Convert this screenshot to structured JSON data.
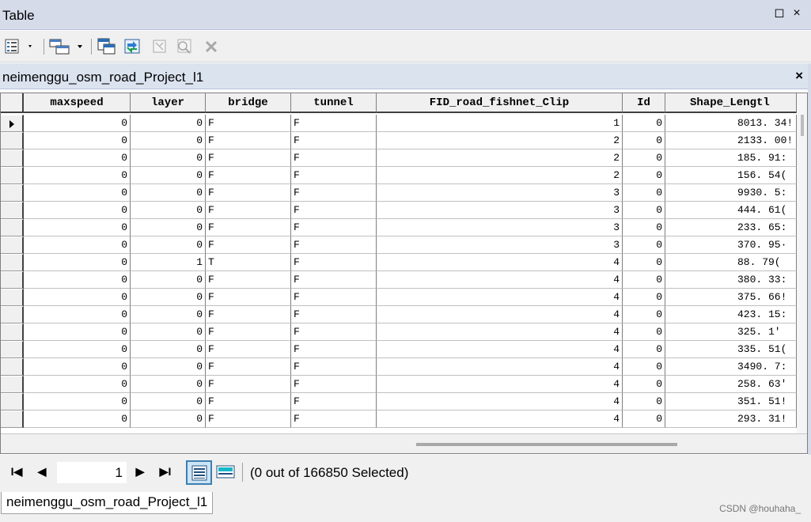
{
  "window": {
    "title": "Table",
    "restore_glyph": "◻",
    "close_glyph": "×"
  },
  "toolbar": {
    "icons": [
      "table-options-icon",
      "related-tables-icon",
      "select-by-attributes-icon",
      "switch-selection-icon",
      "clear-selection-icon",
      "zoom-to-selected-icon",
      "delete-selected-icon"
    ]
  },
  "tab": {
    "title": "neimenggu_osm_road_Project_l1",
    "close_glyph": "×"
  },
  "table": {
    "columns": [
      "maxspeed",
      "layer",
      "bridge",
      "tunnel",
      "FID_road_fishnet_Clip",
      "Id",
      "Shape_Lengtl"
    ],
    "rows": [
      [
        "0",
        "0",
        "F",
        "F",
        "1",
        "0",
        "8013. 34!"
      ],
      [
        "0",
        "0",
        "F",
        "F",
        "2",
        "0",
        "2133. 00!"
      ],
      [
        "0",
        "0",
        "F",
        "F",
        "2",
        "0",
        "185. 91:"
      ],
      [
        "0",
        "0",
        "F",
        "F",
        "2",
        "0",
        "156. 54("
      ],
      [
        "0",
        "0",
        "F",
        "F",
        "3",
        "0",
        "9930. 5:"
      ],
      [
        "0",
        "0",
        "F",
        "F",
        "3",
        "0",
        "444. 61("
      ],
      [
        "0",
        "0",
        "F",
        "F",
        "3",
        "0",
        "233. 65:"
      ],
      [
        "0",
        "0",
        "F",
        "F",
        "3",
        "0",
        "370. 95·"
      ],
      [
        "0",
        "1",
        "T",
        "F",
        "4",
        "0",
        "88. 79("
      ],
      [
        "0",
        "0",
        "F",
        "F",
        "4",
        "0",
        "380. 33:"
      ],
      [
        "0",
        "0",
        "F",
        "F",
        "4",
        "0",
        "375. 66!"
      ],
      [
        "0",
        "0",
        "F",
        "F",
        "4",
        "0",
        "423. 15:"
      ],
      [
        "0",
        "0",
        "F",
        "F",
        "4",
        "0",
        "325. 1'"
      ],
      [
        "0",
        "0",
        "F",
        "F",
        "4",
        "0",
        "335. 51("
      ],
      [
        "0",
        "0",
        "F",
        "F",
        "4",
        "0",
        "3490. 7:"
      ],
      [
        "0",
        "0",
        "F",
        "F",
        "4",
        "0",
        "258. 63'"
      ],
      [
        "0",
        "0",
        "F",
        "F",
        "4",
        "0",
        "351. 51!"
      ],
      [
        "0",
        "0",
        "F",
        "F",
        "4",
        "0",
        "293. 31!"
      ]
    ],
    "current_row": 1
  },
  "nav": {
    "first": "I◀",
    "prev": "◀",
    "record": "1",
    "next": "▶",
    "last": "▶I",
    "selection_status": "(0 out of 166850 Selected)"
  },
  "bottom_tab": {
    "label": "neimenggu_osm_road_Project_l1"
  },
  "watermark": "CSDN @houhaha_"
}
